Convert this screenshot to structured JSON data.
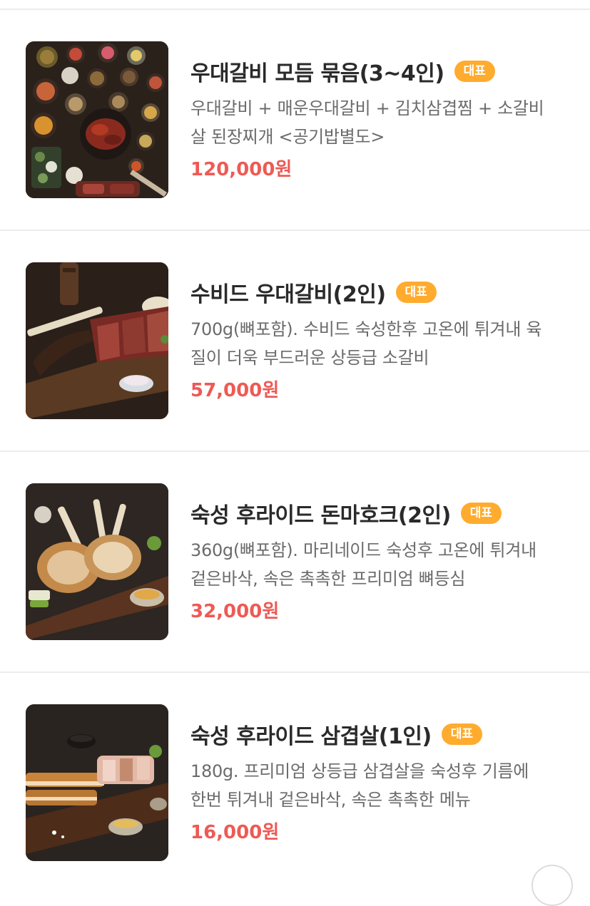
{
  "menu": {
    "items": [
      {
        "name": "우대갈비 모듬 묶음(3~4인)",
        "badge": "대표",
        "desc_line1": "우대갈비 + 매운우대갈비 + 김치삼겹찜 + 소갈비",
        "desc_line2": "살 된장찌개 <공기밥별도>",
        "price": "120,000원",
        "photo": "assorted-dishes-photo"
      },
      {
        "name": "수비드 우대갈비(2인)",
        "badge": "대표",
        "desc_line1": "700g(뼈포함). 수비드 숙성한후 고온에 튀겨내 육",
        "desc_line2": "질이 더욱 부드러운 상등급 소갈비",
        "price": "57,000원",
        "photo": "beef-rib-photo"
      },
      {
        "name": "숙성 후라이드 돈마호크(2인)",
        "badge": "대표",
        "desc_line1": "360g(뼈포함). 마리네이드 숙성후 고온에 튀겨내",
        "desc_line2": "겉은바삭, 속은 촉촉한 프리미엄 뼈등심",
        "price": "32,000원",
        "photo": "pork-tomahawk-photo"
      },
      {
        "name": "숙성 후라이드 삼겹살(1인)",
        "badge": "대표",
        "desc_line1": "180g. 프리미엄 상등급 삼겹살을 숙성후 기름에",
        "desc_line2": "한번 튀겨내 겉은바삭, 속은 촉촉한 메뉴",
        "price": "16,000원",
        "photo": "pork-belly-photo"
      }
    ]
  },
  "colors": {
    "badge_bg": "#ffab2e",
    "price": "#ee5a55",
    "title": "#2a2a2a",
    "desc": "#6b6b6b",
    "divider": "#ececf0"
  }
}
